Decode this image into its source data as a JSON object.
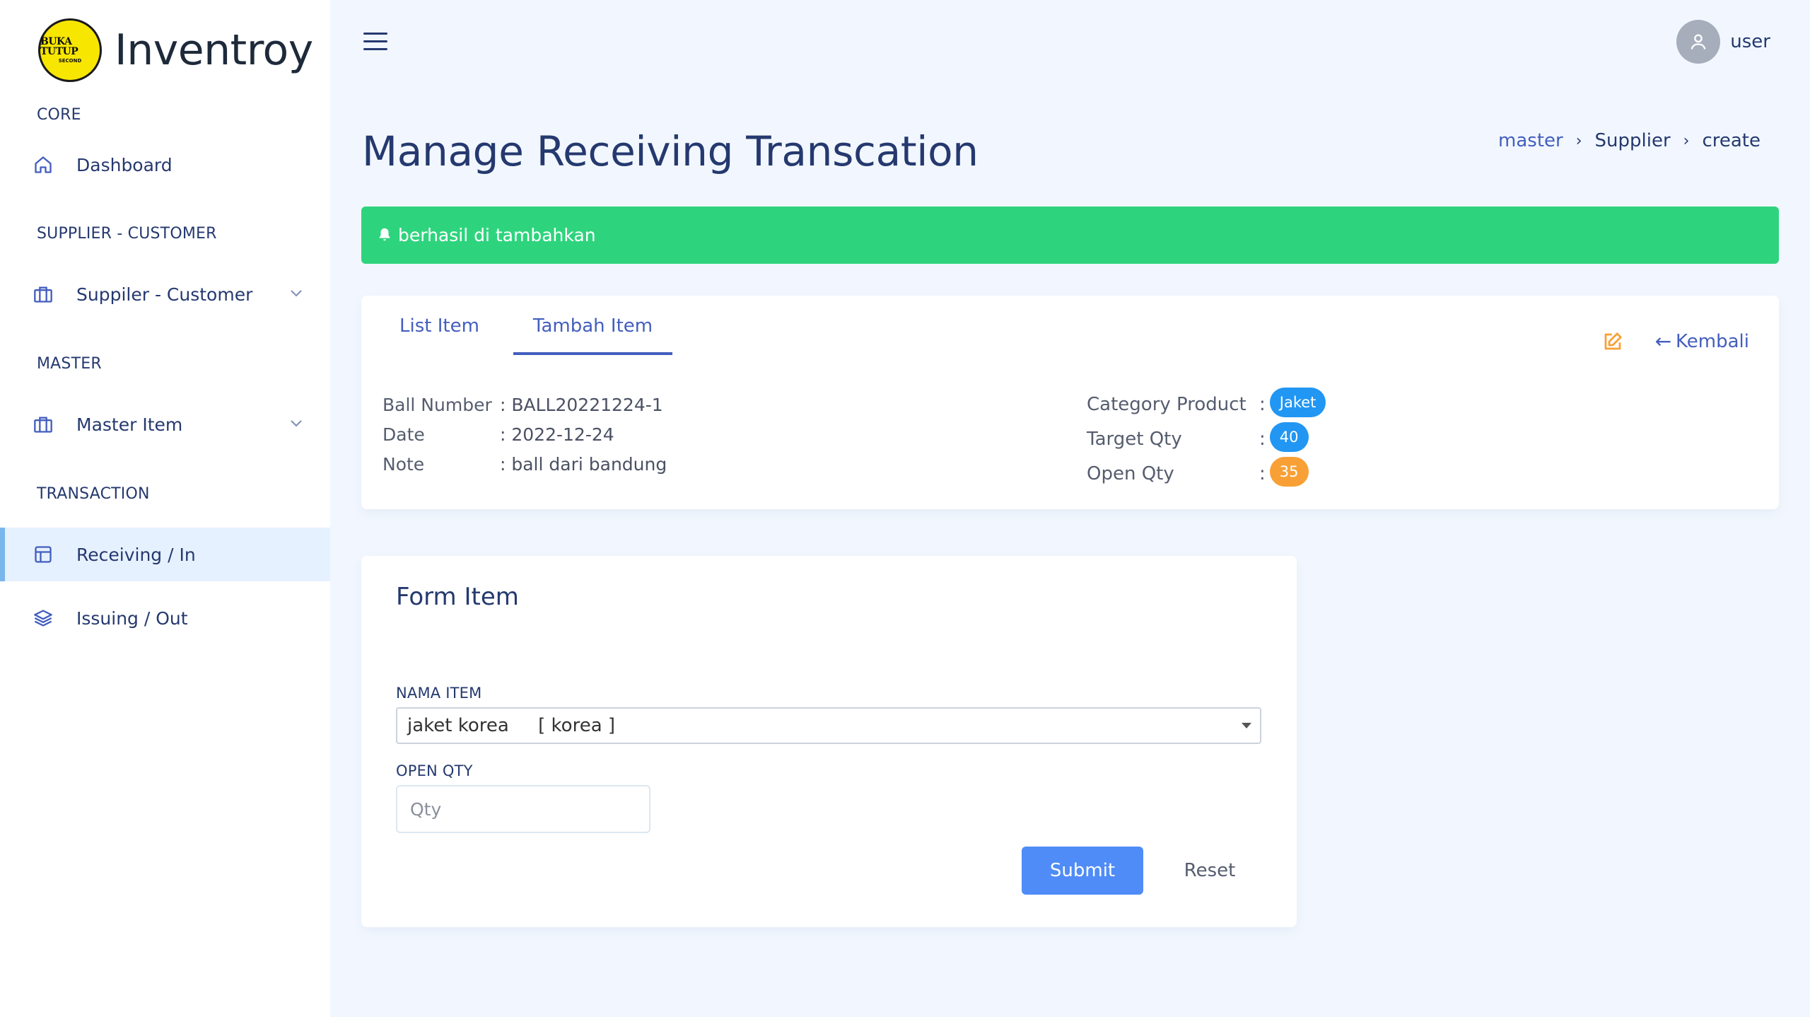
{
  "brand": {
    "logo_line1": "BUKA TUTUP",
    "logo_line2": "SECOND",
    "name": "Inventroy"
  },
  "sidebar": {
    "sections": [
      "CORE",
      "SUPPLIER - CUSTOMER",
      "MASTER",
      "TRANSACTION"
    ],
    "items": [
      {
        "label": "Dashboard",
        "icon": "home-icon"
      },
      {
        "label": "Suppiler - Customer",
        "icon": "briefcase-icon",
        "has_submenu": true
      },
      {
        "label": "Master Item",
        "icon": "briefcase-icon",
        "has_submenu": true
      },
      {
        "label": "Receiving / In",
        "icon": "table-icon",
        "active": true
      },
      {
        "label": "Issuing / Out",
        "icon": "layers-icon"
      }
    ]
  },
  "topbar": {
    "menu_icon": "hamburger-icon",
    "user_name": "user"
  },
  "page": {
    "title": "Manage Receiving Transcation",
    "breadcrumb": [
      "master",
      "Supplier",
      "create"
    ]
  },
  "alert": {
    "icon": "bell-icon",
    "message": "berhasil di tambahkan",
    "color": "#2ed47d"
  },
  "info_card": {
    "tabs": [
      "List Item",
      "Tambah Item"
    ],
    "active_tab": "Tambah Item",
    "back_label": "Kembali",
    "details_left": [
      {
        "key": "Ball Number",
        "value": ": BALL20221224-1"
      },
      {
        "key": "Date",
        "value": ": 2022-12-24"
      },
      {
        "key": "Note",
        "value": ": ball dari bandung"
      }
    ],
    "details_right": [
      {
        "key": "Category Product",
        "value": "Jaket",
        "color": "#2196f3"
      },
      {
        "key": "Target Qty",
        "value": "40",
        "color": "#2196f3"
      },
      {
        "key": "Open Qty",
        "value": "35",
        "color": "#f8a035"
      }
    ]
  },
  "form": {
    "title": "Form Item",
    "nama_item_label": "NAMA ITEM",
    "nama_item_value": "jaket korea     [ korea ]",
    "open_qty_label": "OPEN QTY",
    "open_qty_placeholder": "Qty",
    "submit_label": "Submit",
    "reset_label": "Reset"
  },
  "colors": {
    "accent": "#435ebe",
    "text": "#25396f",
    "background": "#f2f7ff",
    "submit": "#4f8cf7"
  }
}
